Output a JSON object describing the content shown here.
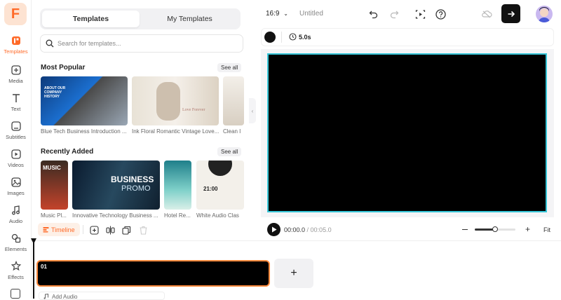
{
  "rail": {
    "items": [
      {
        "label": "Templates",
        "icon": "templates-icon",
        "active": true
      },
      {
        "label": "Media",
        "icon": "media-icon"
      },
      {
        "label": "Text",
        "icon": "text-icon"
      },
      {
        "label": "Subtitles",
        "icon": "subtitles-icon"
      },
      {
        "label": "Videos",
        "icon": "videos-icon"
      },
      {
        "label": "Images",
        "icon": "images-icon"
      },
      {
        "label": "Audio",
        "icon": "audio-icon"
      },
      {
        "label": "Elements",
        "icon": "elements-icon"
      },
      {
        "label": "Effects",
        "icon": "effects-icon"
      }
    ]
  },
  "panel": {
    "tabs": [
      "Templates",
      "My Templates"
    ],
    "search_placeholder": "Search for templates...",
    "most_popular": {
      "title": "Most Popular",
      "see_all": "See all",
      "items": [
        "Blue Tech Business Introduction ...",
        "Ink Floral Romantic Vintage Love...",
        "Clean I"
      ],
      "thumb_text": [
        "ABOUT OUR COMPANY HISTORY",
        "Love Forever"
      ]
    },
    "recently_added": {
      "title": "Recently Added",
      "see_all": "See all",
      "items": [
        "Music Pl...",
        "Innovative Technology Business ...",
        "Hotel Re...",
        "White Audio Clas"
      ],
      "thumb_text": [
        "MUSIC",
        "BUSINESS",
        "PROMO",
        "21:00"
      ]
    }
  },
  "topbar": {
    "aspect": "16:9",
    "title": "Untitled"
  },
  "stage": {
    "duration": "5.0s"
  },
  "player": {
    "current": "00:00.0",
    "separator": " / ",
    "total": "00:05.0",
    "zoom_level": 0.5,
    "fit": "Fit"
  },
  "timeline": {
    "tab_label": "Timeline",
    "clip_number": "01",
    "add_clip": "+",
    "add_audio": "Add Audio"
  },
  "colors": {
    "accent": "#ff6a28",
    "stage_border": "#36c6d8",
    "clip_border": "#ff8a3d"
  }
}
